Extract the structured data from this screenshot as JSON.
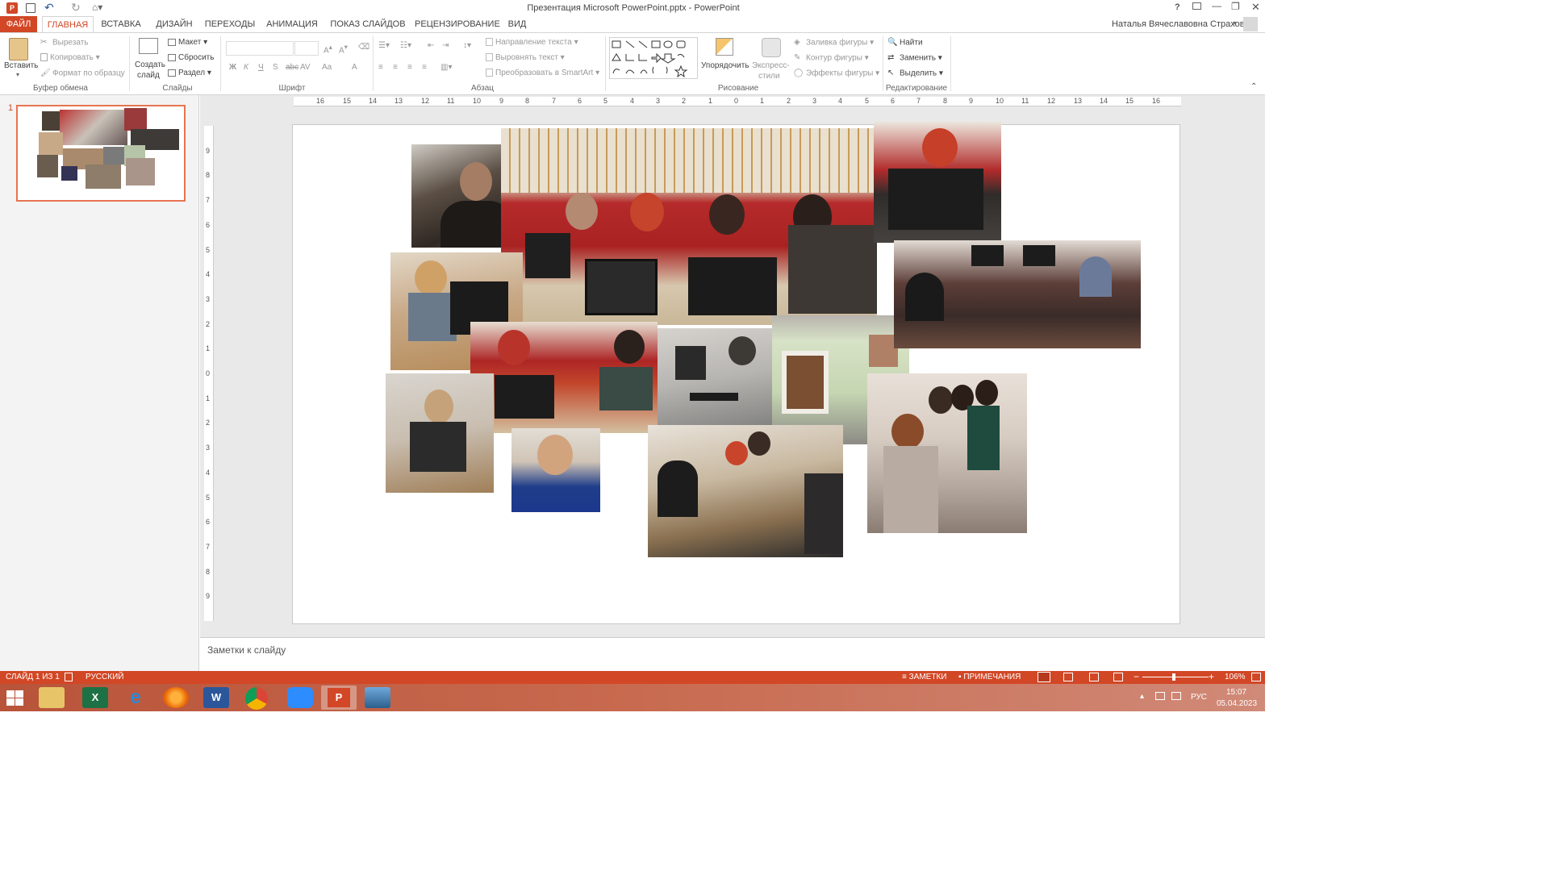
{
  "window": {
    "title": "Презентация Microsoft PowerPoint.pptx - PowerPoint",
    "help": "?",
    "controls": [
      "?",
      "—",
      "❐",
      "✕"
    ]
  },
  "tabs": {
    "file": "ФАЙЛ",
    "items": [
      "ГЛАВНАЯ",
      "ВСТАВКА",
      "ДИЗАЙН",
      "ПЕРЕХОДЫ",
      "АНИМАЦИЯ",
      "ПОКАЗ СЛАЙДОВ",
      "РЕЦЕНЗИРОВАНИЕ",
      "ВИД"
    ],
    "active": "ГЛАВНАЯ",
    "user": "Наталья Вячеславовна Страхова"
  },
  "ribbon": {
    "clipboard": {
      "paste": "Вставить",
      "cut": "Вырезать",
      "copy": "Копировать",
      "format_painter": "Формат по образцу",
      "label": "Буфер обмена"
    },
    "slides": {
      "new_slide": "Создать слайд",
      "new_slide_l1": "Создать",
      "new_slide_l2": "слайд",
      "layout": "Макет",
      "reset": "Сбросить",
      "section": "Раздел",
      "label": "Слайды"
    },
    "font": {
      "label": "Шрифт",
      "bold": "Ж",
      "italic": "К",
      "underline": "Ч",
      "strike": "S",
      "abc": "abc",
      "spacing": "AV",
      "case": "Aa",
      "color": "A"
    },
    "paragraph": {
      "text_direction": "Направление текста",
      "align_text": "Выровнять текст",
      "smartart": "Преобразовать в SmartArt",
      "label": "Абзац"
    },
    "drawing": {
      "arrange": "Упорядочить",
      "quick_styles_l1": "Экспресс-",
      "quick_styles_l2": "стили",
      "shape_fill": "Заливка фигуры",
      "shape_outline": "Контур фигуры",
      "shape_effects": "Эффекты фигуры",
      "label": "Рисование"
    },
    "editing": {
      "find": "Найти",
      "replace": "Заменить",
      "select": "Выделить",
      "label": "Редактирование"
    }
  },
  "thumbnail": {
    "number": "1"
  },
  "ruler": {
    "h_ticks": [
      "16",
      "15",
      "14",
      "13",
      "12",
      "11",
      "10",
      "9",
      "8",
      "7",
      "6",
      "5",
      "4",
      "3",
      "2",
      "1",
      "0",
      "1",
      "2",
      "3",
      "4",
      "5",
      "6",
      "7",
      "8",
      "9",
      "10",
      "11",
      "12",
      "13",
      "14",
      "15",
      "16"
    ],
    "v_ticks": [
      "9",
      "8",
      "7",
      "6",
      "5",
      "4",
      "3",
      "2",
      "1",
      "0",
      "1",
      "2",
      "3",
      "4",
      "5",
      "6",
      "7",
      "8",
      "9"
    ]
  },
  "notes": {
    "placeholder": "Заметки к слайду"
  },
  "status": {
    "slide": "СЛАЙД 1 ИЗ 1",
    "language": "РУССКИЙ",
    "notes": "ЗАМЕТКИ",
    "comments": "ПРИМЕЧАНИЯ",
    "zoom": "106%"
  },
  "taskbar": {
    "lang": "РУС",
    "time": "15:07",
    "date": "05.04.2023"
  },
  "colors": {
    "accent": "#d24726",
    "thumb_border": "#e8744f"
  },
  "icons": [
    "powerpoint-icon",
    "save-icon",
    "undo-icon",
    "redo-icon",
    "paste-icon",
    "scissors-icon",
    "copy-icon",
    "brush-icon",
    "new-slide-icon",
    "find-icon",
    "replace-icon",
    "select-icon",
    "windows-start-icon",
    "file-explorer-icon",
    "excel-icon",
    "ie-icon",
    "firefox-icon",
    "word-icon",
    "chrome-icon",
    "zoom-icon",
    "powerpoint-taskbar-icon",
    "photos-icon"
  ]
}
